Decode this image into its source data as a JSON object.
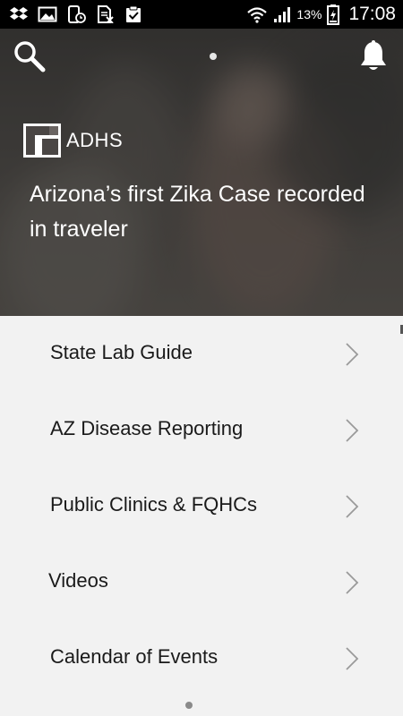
{
  "status_bar": {
    "icons": [
      "dropbox-icon",
      "image-icon",
      "phone-clock-icon",
      "sim-off-icon",
      "clipboard-check-icon"
    ],
    "battery_percent": "13%",
    "time": "17:08"
  },
  "hero": {
    "logo_text": "ADHS",
    "headline": "Arizona’s first Zika Case recorded in traveler"
  },
  "menu": {
    "items": [
      {
        "label": "State Lab Guide"
      },
      {
        "label": "AZ Disease Reporting"
      },
      {
        "label": "Public Clinics & FQHCs"
      },
      {
        "label": "Videos"
      },
      {
        "label": "Calendar of Events"
      }
    ]
  },
  "colors": {
    "status_bar_bg": "#000000",
    "list_bg": "#f2f2f2",
    "text_dark": "#1a1a1a",
    "chevron": "#9a9a9a"
  }
}
